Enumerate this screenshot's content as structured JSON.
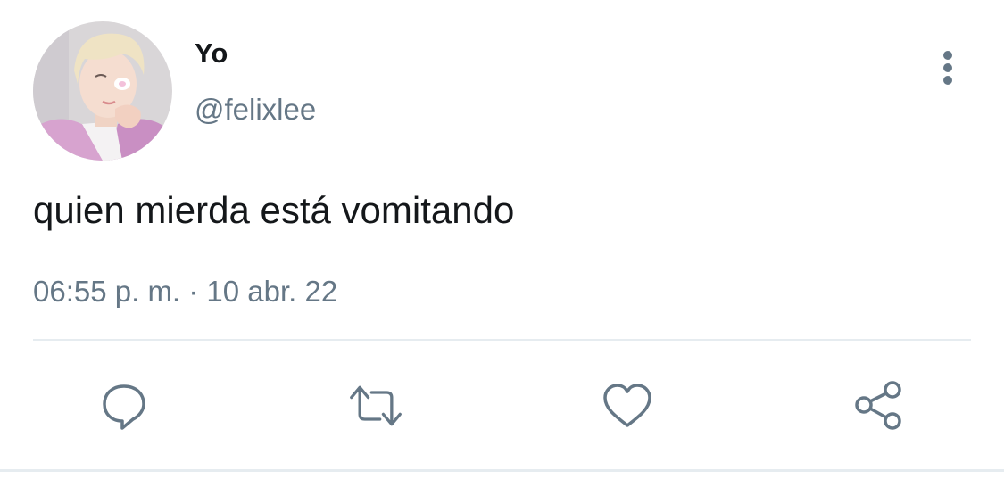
{
  "tweet": {
    "display_name": "Yo",
    "handle": "@felixlee",
    "text": "quien mierda está vomitando",
    "timestamp": "06:55 p. m. · 10 abr. 22"
  },
  "actions": [
    {
      "name": "reply",
      "icon": "speech-bubble-icon"
    },
    {
      "name": "retweet",
      "icon": "retweet-icon"
    },
    {
      "name": "like",
      "icon": "heart-icon"
    },
    {
      "name": "share",
      "icon": "share-icon"
    }
  ],
  "colors": {
    "text_primary": "#14171a",
    "text_secondary": "#657786",
    "icon": "#657786",
    "divider": "#e6ecf0"
  }
}
